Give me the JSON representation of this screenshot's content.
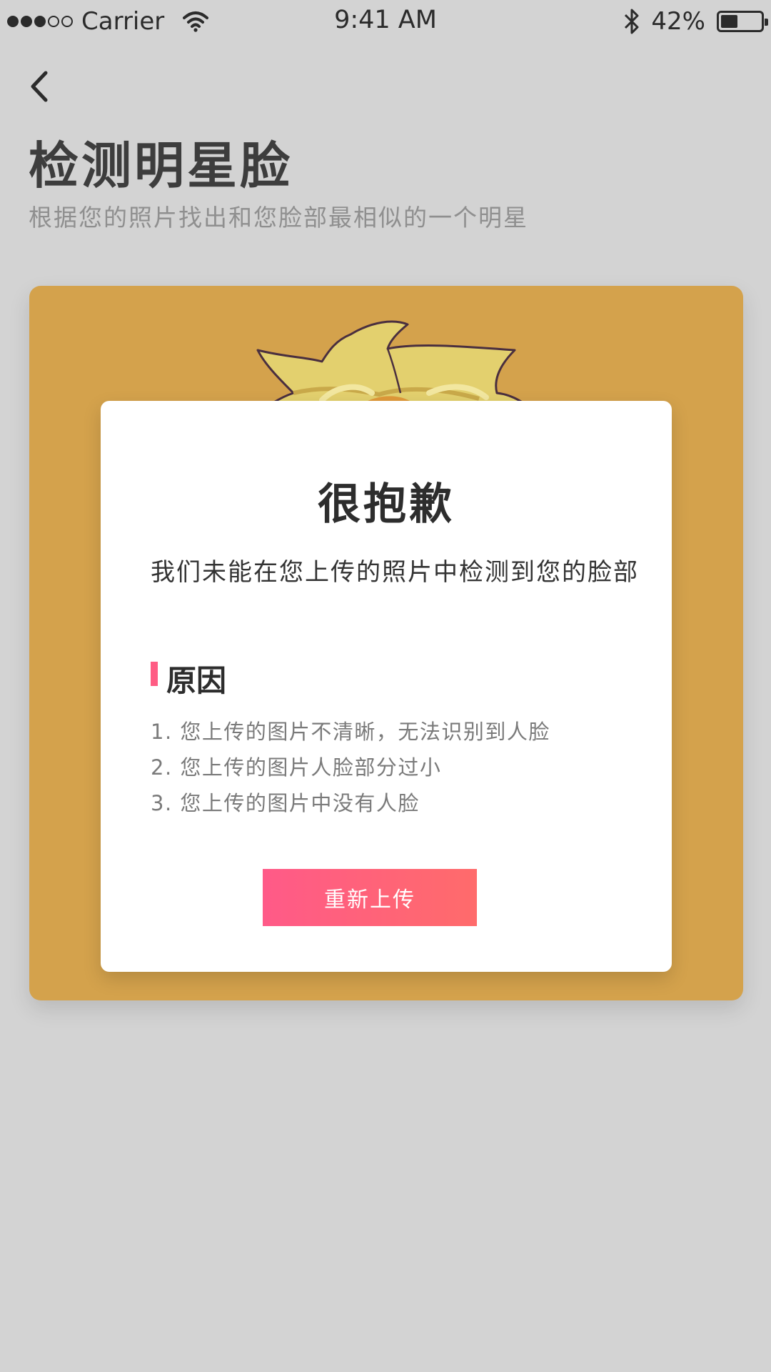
{
  "status_bar": {
    "carrier": "Carrier",
    "time": "9:41 AM",
    "battery": "42%",
    "battery_level": 0.42,
    "signal_bars_filled": 3,
    "signal_bars_total": 5
  },
  "header": {
    "title": "检测明星脸",
    "subtitle": "根据您的照片找出和您脸部最相似的一个明星"
  },
  "dialog": {
    "title": "很抱歉",
    "message": "我们未能在您上传的照片中检测到您的脸部",
    "reason_heading": "原因",
    "reasons": [
      "1. 您上传的图片不清晰，无法识别到人脸",
      "2. 您上传的图片人脸部分过小",
      "3. 您上传的图片中没有人脸"
    ],
    "button_label": "重新上传"
  },
  "colors": {
    "background": "#d3d3d3",
    "card": "#d4a24c",
    "accent": "#ff5c84",
    "button_gradient_start": "#ff5a88",
    "button_gradient_end": "#ff6b6b"
  }
}
